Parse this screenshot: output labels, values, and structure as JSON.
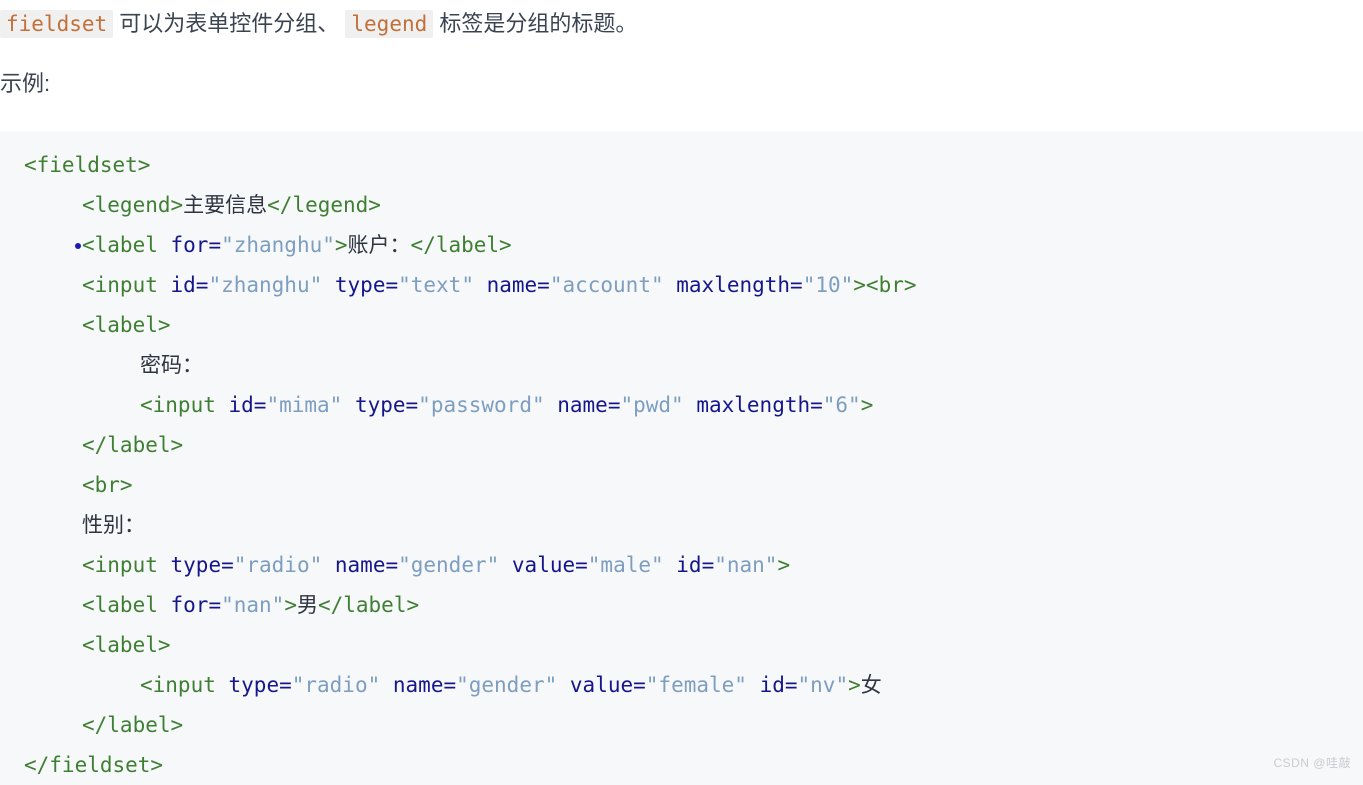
{
  "intro": {
    "sentence_parts": {
      "code_1": "fieldset",
      "text_1": " 可以为表单控件分组、 ",
      "code_2": "legend",
      "text_2": " 标签是分组的标题。"
    },
    "example_label": "示例:"
  },
  "code_block": {
    "language": "html",
    "lines": [
      {
        "indent": 0,
        "tokens": [
          {
            "t": "tag",
            "v": "<fieldset>"
          }
        ]
      },
      {
        "indent": 4,
        "tokens": [
          {
            "t": "tag",
            "v": "<legend>"
          },
          {
            "t": "text",
            "v": "主要信息"
          },
          {
            "t": "tag",
            "v": "</legend>"
          }
        ]
      },
      {
        "indent": 4,
        "caret": true,
        "tokens": [
          {
            "t": "tag",
            "v": "<label "
          },
          {
            "t": "attr",
            "v": "for="
          },
          {
            "t": "val",
            "v": "\"zhanghu\""
          },
          {
            "t": "tag",
            "v": ">"
          },
          {
            "t": "text",
            "v": "账户："
          },
          {
            "t": "tag",
            "v": "</label>"
          }
        ]
      },
      {
        "indent": 4,
        "tokens": [
          {
            "t": "tag",
            "v": "<input "
          },
          {
            "t": "attr",
            "v": "id="
          },
          {
            "t": "val",
            "v": "\"zhanghu\""
          },
          {
            "t": "attr",
            "v": " type="
          },
          {
            "t": "val",
            "v": "\"text\""
          },
          {
            "t": "attr",
            "v": " name="
          },
          {
            "t": "val",
            "v": "\"account\""
          },
          {
            "t": "attr",
            "v": " maxlength="
          },
          {
            "t": "val",
            "v": "\"10\""
          },
          {
            "t": "tag",
            "v": "><br>"
          }
        ]
      },
      {
        "indent": 4,
        "tokens": [
          {
            "t": "tag",
            "v": "<label>"
          }
        ]
      },
      {
        "indent": 8,
        "tokens": [
          {
            "t": "text",
            "v": "密码："
          }
        ]
      },
      {
        "indent": 8,
        "tokens": [
          {
            "t": "tag",
            "v": "<input "
          },
          {
            "t": "attr",
            "v": "id="
          },
          {
            "t": "val",
            "v": "\"mima\""
          },
          {
            "t": "attr",
            "v": " type="
          },
          {
            "t": "val",
            "v": "\"password\""
          },
          {
            "t": "attr",
            "v": " name="
          },
          {
            "t": "val",
            "v": "\"pwd\""
          },
          {
            "t": "attr",
            "v": " maxlength="
          },
          {
            "t": "val",
            "v": "\"6\""
          },
          {
            "t": "tag",
            "v": ">"
          }
        ]
      },
      {
        "indent": 4,
        "tokens": [
          {
            "t": "tag",
            "v": "</label>"
          }
        ]
      },
      {
        "indent": 4,
        "tokens": [
          {
            "t": "tag",
            "v": "<br>"
          }
        ]
      },
      {
        "indent": 4,
        "tokens": [
          {
            "t": "text",
            "v": "性别："
          }
        ]
      },
      {
        "indent": 4,
        "tokens": [
          {
            "t": "tag",
            "v": "<input "
          },
          {
            "t": "attr",
            "v": "type="
          },
          {
            "t": "val",
            "v": "\"radio\""
          },
          {
            "t": "attr",
            "v": " name="
          },
          {
            "t": "val",
            "v": "\"gender\""
          },
          {
            "t": "attr",
            "v": " value="
          },
          {
            "t": "val",
            "v": "\"male\""
          },
          {
            "t": "attr",
            "v": " id="
          },
          {
            "t": "val",
            "v": "\"nan\""
          },
          {
            "t": "tag",
            "v": ">"
          }
        ]
      },
      {
        "indent": 4,
        "tokens": [
          {
            "t": "tag",
            "v": "<label "
          },
          {
            "t": "attr",
            "v": "for="
          },
          {
            "t": "val",
            "v": "\"nan\""
          },
          {
            "t": "tag",
            "v": ">"
          },
          {
            "t": "text",
            "v": "男"
          },
          {
            "t": "tag",
            "v": "</label>"
          }
        ]
      },
      {
        "indent": 4,
        "tokens": [
          {
            "t": "tag",
            "v": "<label>"
          }
        ]
      },
      {
        "indent": 8,
        "tokens": [
          {
            "t": "tag",
            "v": "<input "
          },
          {
            "t": "attr",
            "v": "type="
          },
          {
            "t": "val",
            "v": "\"radio\""
          },
          {
            "t": "attr",
            "v": " name="
          },
          {
            "t": "val",
            "v": "\"gender\""
          },
          {
            "t": "attr",
            "v": " value="
          },
          {
            "t": "val",
            "v": "\"female\""
          },
          {
            "t": "attr",
            "v": " id="
          },
          {
            "t": "val",
            "v": "\"nv\""
          },
          {
            "t": "tag",
            "v": ">"
          },
          {
            "t": "text",
            "v": "女"
          }
        ]
      },
      {
        "indent": 4,
        "tokens": [
          {
            "t": "tag",
            "v": "</label>"
          }
        ]
      },
      {
        "indent": 0,
        "tokens": [
          {
            "t": "tag",
            "v": "</fieldset>"
          }
        ]
      }
    ]
  },
  "watermark": {
    "text": "CSDN @哇敲"
  },
  "colors": {
    "tag": "#3f7f33",
    "attribute_name": "#16168c",
    "attribute_value": "#7d9ec0",
    "inline_code_text": "#c2703a",
    "inline_code_bg": "#f0f0f0",
    "code_block_bg": "#f7f8f9",
    "prose_text": "#3b4351",
    "watermark": "#c8ccd2"
  }
}
